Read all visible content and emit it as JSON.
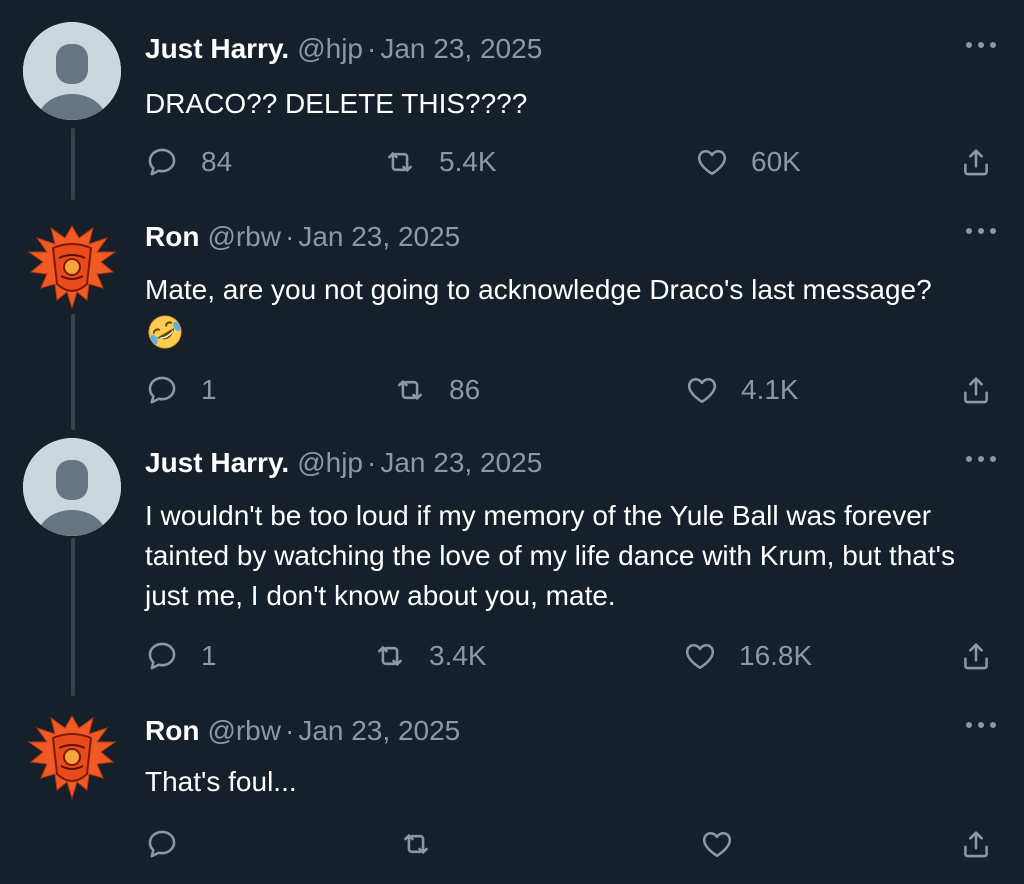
{
  "colors": {
    "background": "#15202b",
    "text": "#ffffff",
    "muted": "#8b98a5",
    "thread_line": "#38444d",
    "avatar_default": "#ccd6dd",
    "crest_orange": "#f15a24"
  },
  "tweets": [
    {
      "name": "Just Harry.",
      "handle": "@hjp",
      "separator": "·",
      "date": "Jan 23, 2025",
      "text": "DRACO?? DELETE THIS????",
      "avatar_icon": "default-profile-icon",
      "replies": "84",
      "retweets": "5.4K",
      "likes": "60K"
    },
    {
      "name": "Ron",
      "handle": "@rbw",
      "separator": "·",
      "date": "Jan 23, 2025",
      "text": "Mate, are you not going to acknowledge Draco's last message?",
      "emoji": "rolling-on-floor-laughing-emoji",
      "avatar_icon": "phoenix-crest-icon",
      "replies": "1",
      "retweets": "86",
      "likes": "4.1K"
    },
    {
      "name": "Just Harry.",
      "handle": "@hjp",
      "separator": "·",
      "date": "Jan 23, 2025",
      "text": "I wouldn't be too loud if my memory of the Yule Ball was forever tainted by watching the love of my life dance with Krum, but that's just me, I don't know about you, mate.",
      "avatar_icon": "default-profile-icon",
      "replies": "1",
      "retweets": "3.4K",
      "likes": "16.8K"
    },
    {
      "name": "Ron",
      "handle": "@rbw",
      "separator": "·",
      "date": "Jan 23, 2025",
      "text": "That's foul...",
      "avatar_icon": "phoenix-crest-icon",
      "replies": "",
      "retweets": "",
      "likes": ""
    }
  ],
  "icons": {
    "reply": "reply-icon",
    "retweet": "retweet-icon",
    "like": "heart-icon",
    "share": "share-icon",
    "more": "more-options-icon"
  }
}
